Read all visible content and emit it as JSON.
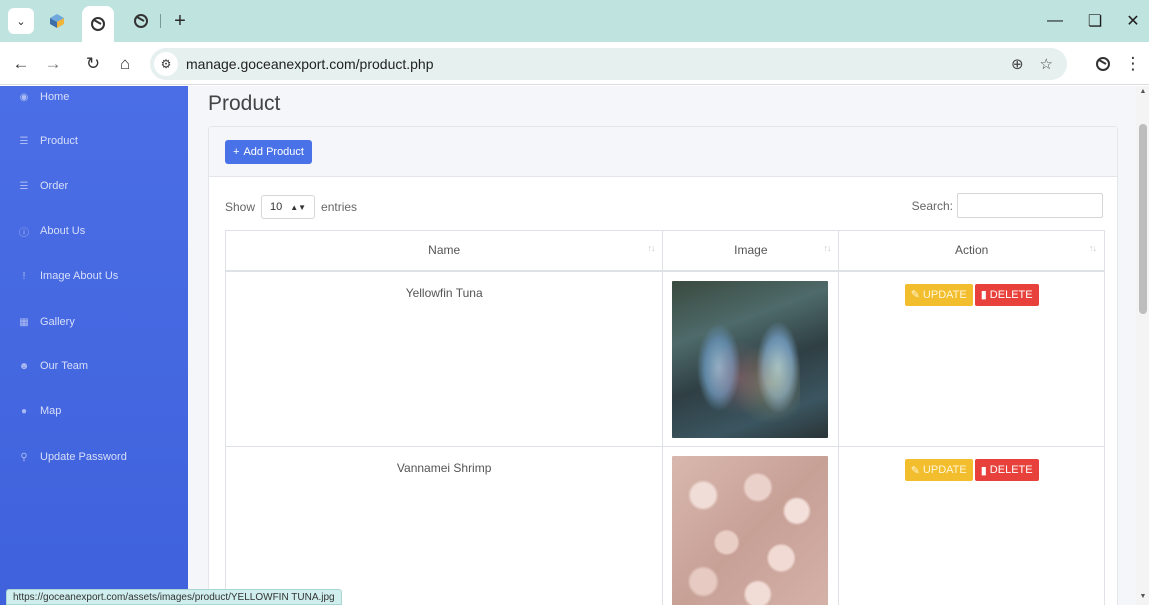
{
  "browser": {
    "url": "manage.goceanexport.com/product.php",
    "new_tab_label": "+",
    "status_url": "https://goceanexport.com/assets/images/product/YELLOWFIN TUNA.jpg"
  },
  "sidebar": {
    "items": [
      {
        "label": "Home",
        "icon": "dashboard-icon"
      },
      {
        "label": "Product",
        "icon": "cart-icon"
      },
      {
        "label": "Order",
        "icon": "cart-icon"
      },
      {
        "label": "About Us",
        "icon": "info-icon"
      },
      {
        "label": "Image About Us",
        "icon": "exclamation-icon"
      },
      {
        "label": "Gallery",
        "icon": "book-icon"
      },
      {
        "label": "Our Team",
        "icon": "users-icon"
      },
      {
        "label": "Map",
        "icon": "map-pin-icon"
      },
      {
        "label": "Update Password",
        "icon": "key-icon"
      }
    ]
  },
  "page": {
    "title": "Product",
    "add_button": "Add Product",
    "show_label": "Show",
    "entries_value": "10",
    "entries_label": "entries",
    "search_label": "Search:"
  },
  "table": {
    "columns": [
      "Name",
      "Image",
      "Action"
    ],
    "rows": [
      {
        "name": "Yellowfin Tuna",
        "image": "yellowfin-tuna-photo"
      },
      {
        "name": "Vannamei Shrimp",
        "image": "vannamei-shrimp-photo"
      }
    ],
    "update_label": "UPDATE",
    "delete_label": "DELETE"
  },
  "colors": {
    "sidebar": "#4b6ee6",
    "primary": "#4a72e8",
    "warning": "#f3be2d",
    "danger": "#e8403b"
  }
}
